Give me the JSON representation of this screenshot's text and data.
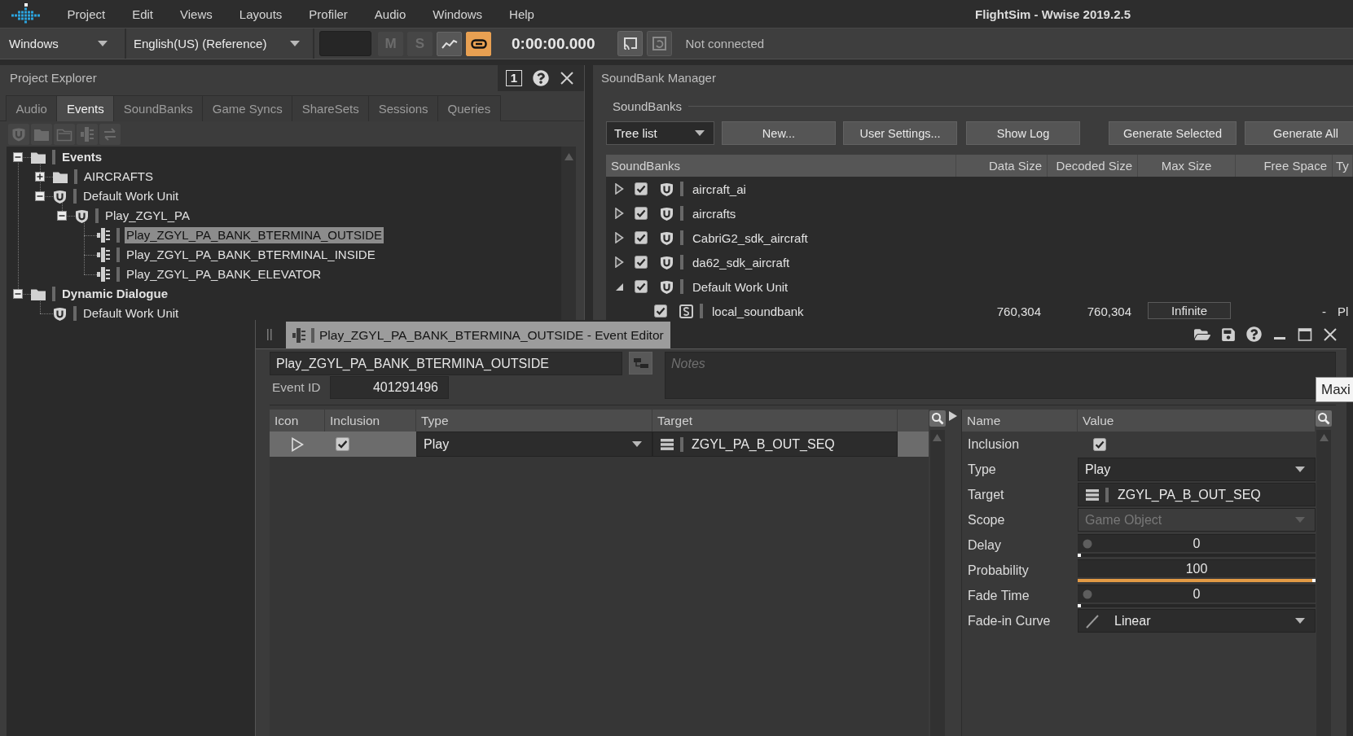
{
  "app": {
    "menu": [
      "Project",
      "Edit",
      "Views",
      "Layouts",
      "Profiler",
      "Audio",
      "Windows",
      "Help"
    ],
    "title": "FlightSim - Wwise 2019.2.5"
  },
  "toolbar": {
    "layout": "Windows",
    "language": "English(US) (Reference)",
    "buttons": [
      {
        "kind": "text",
        "label": "M",
        "disabled": true,
        "on": false
      },
      {
        "kind": "text",
        "label": "S",
        "disabled": true,
        "on": false
      },
      {
        "kind": "graph",
        "disabled": false,
        "on": false
      },
      {
        "kind": "link",
        "disabled": false,
        "on": true
      }
    ],
    "time": "0:00:00.000",
    "connection": "Not connected"
  },
  "project_explorer": {
    "title": "Project Explorer",
    "pane_number": "1",
    "tabs": [
      {
        "label": "Audio",
        "selected": false
      },
      {
        "label": "Events",
        "selected": true
      },
      {
        "label": "SoundBanks",
        "selected": false
      },
      {
        "label": "Game Syncs",
        "selected": false
      },
      {
        "label": "ShareSets",
        "selected": false
      },
      {
        "label": "Sessions",
        "selected": false
      },
      {
        "label": "Queries",
        "selected": false
      }
    ],
    "tools_disabled": true,
    "tree": [
      {
        "label": "Events",
        "kind": "folder",
        "expanded": true,
        "selected": false,
        "children": [
          {
            "label": "AIRCRAFTS",
            "kind": "folder",
            "expanded": false,
            "selected": false
          },
          {
            "label": "Default Work Unit",
            "kind": "workunit",
            "expanded": true,
            "selected": false,
            "children": [
              {
                "label": "Play_ZGYL_PA",
                "kind": "workunit",
                "expanded": true,
                "selected": false,
                "children": [
                  {
                    "label": "Play_ZGYL_PA_BANK_BTERMINA_OUTSIDE",
                    "kind": "event",
                    "selected": true
                  },
                  {
                    "label": "Play_ZGYL_PA_BANK_BTERMINAL_INSIDE",
                    "kind": "event",
                    "selected": false
                  },
                  {
                    "label": "Play_ZGYL_PA_BANK_ELEVATOR",
                    "kind": "event",
                    "selected": false
                  }
                ]
              }
            ]
          }
        ]
      },
      {
        "label": "Dynamic Dialogue",
        "kind": "folder",
        "expanded": true,
        "selected": false,
        "children": [
          {
            "label": "Default Work Unit",
            "kind": "workunit",
            "selected": false
          }
        ]
      }
    ]
  },
  "soundbank_manager": {
    "title": "SoundBank Manager",
    "group": "SoundBanks",
    "view": "Tree list",
    "buttons": [
      "New...",
      "User Settings...",
      "Show Log"
    ],
    "generate_buttons": [
      "Generate Selected",
      "Generate All"
    ],
    "columns": [
      "SoundBanks",
      "Data Size",
      "Decoded Size",
      "Max Size",
      "Free Space",
      "Ty"
    ],
    "rows": [
      {
        "name": "aircraft_ai",
        "kind": "workunit",
        "expanded": false,
        "checked": true
      },
      {
        "name": "aircrafts",
        "kind": "workunit",
        "expanded": false,
        "checked": true
      },
      {
        "name": "CabriG2_sdk_aircraft",
        "kind": "workunit",
        "expanded": false,
        "checked": true
      },
      {
        "name": "da62_sdk_aircraft",
        "kind": "workunit",
        "expanded": false,
        "checked": true
      },
      {
        "name": "Default Work Unit",
        "kind": "workunit",
        "expanded": true,
        "checked": true,
        "children": [
          {
            "name": "local_soundbank",
            "kind": "soundbank",
            "checked": true,
            "data_size": "760,304",
            "decoded_size": "760,304",
            "max_size": "Infinite",
            "free_space": "-",
            "column_6": "Pl"
          }
        ]
      }
    ]
  },
  "event_editor": {
    "tab_title": "Play_ZGYL_PA_BANK_BTERMINA_OUTSIDE - Event Editor",
    "name": "Play_ZGYL_PA_BANK_BTERMINA_OUTSIDE",
    "event_id_label": "Event ID",
    "event_id": "401291496",
    "notes": {
      "placeholder": "Notes"
    },
    "actions": {
      "columns": [
        "Icon",
        "Inclusion",
        "Type",
        "Target"
      ],
      "rows": [
        {
          "type": "Play",
          "checked": true,
          "target": "ZGYL_PA_B_OUT_SEQ",
          "selected": true
        }
      ]
    },
    "properties": {
      "columns": [
        "Name",
        "Value"
      ],
      "rows": [
        {
          "kind": "checkbox",
          "name": "Inclusion",
          "checked": true
        },
        {
          "kind": "dropdown",
          "name": "Type",
          "value": "Play",
          "disabled": false
        },
        {
          "kind": "reference",
          "name": "Target",
          "value": "ZGYL_PA_B_OUT_SEQ"
        },
        {
          "kind": "dropdown",
          "name": "Scope",
          "value": "Game Object",
          "disabled": true
        },
        {
          "kind": "slider",
          "name": "Delay",
          "value": "0",
          "level": 0,
          "indicator": true
        },
        {
          "kind": "slider",
          "name": "Probability",
          "value": "100",
          "level": 1,
          "indicator": false
        },
        {
          "kind": "slider",
          "name": "Fade Time",
          "value": "0",
          "level": 0,
          "indicator": true
        },
        {
          "kind": "curve",
          "name": "Fade-in Curve",
          "value": "Linear"
        }
      ]
    },
    "tooltip": "Maxi"
  }
}
